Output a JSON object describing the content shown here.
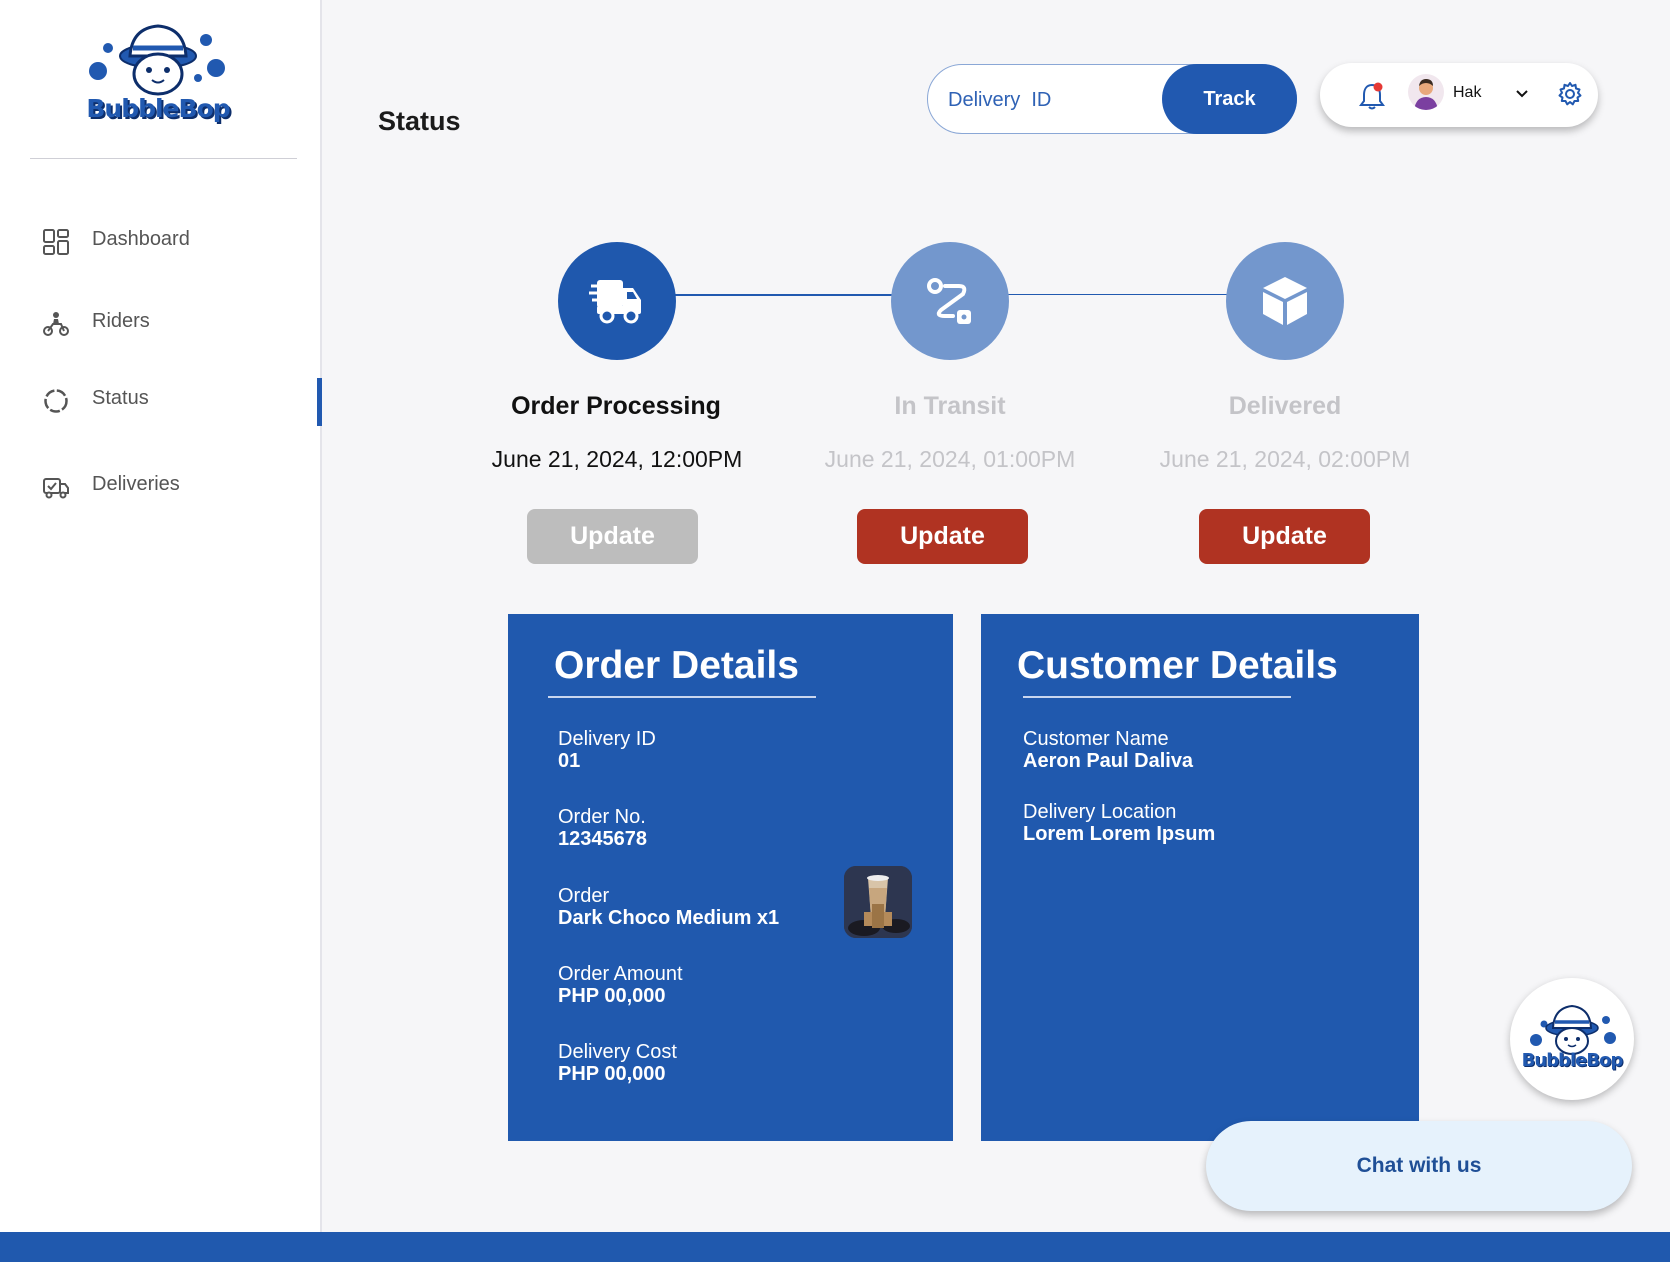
{
  "brand": {
    "logo_text": "BubbleBop"
  },
  "sidebar": {
    "items": [
      {
        "label": "Dashboard",
        "icon": "dashboard-icon"
      },
      {
        "label": "Riders",
        "icon": "motorbike-rider-icon"
      },
      {
        "label": "Status",
        "icon": "status-ring-icon",
        "active": true
      },
      {
        "label": "Deliveries",
        "icon": "delivery-truck-check-icon"
      }
    ]
  },
  "header": {
    "page_title": "Status",
    "track": {
      "placeholder": "Delivery  ID",
      "button_label": "Track"
    },
    "user": {
      "name": "Hak"
    }
  },
  "steps": [
    {
      "title": "Order Processing",
      "date": "June 21, 2024, 12:00PM",
      "state": "active",
      "icon": "delivery-truck-icon",
      "button_label": "Update",
      "button_state": "disabled"
    },
    {
      "title": "In Transit",
      "date": "June 21, 2024, 01:00PM",
      "state": "pending",
      "icon": "route-icon",
      "button_label": "Update",
      "button_state": "enabled"
    },
    {
      "title": "Delivered",
      "date": "June 21, 2024, 02:00PM",
      "state": "pending",
      "icon": "package-box-icon",
      "button_label": "Update",
      "button_state": "enabled"
    }
  ],
  "order_details": {
    "title": "Order Details",
    "fields": [
      {
        "label": "Delivery ID",
        "value": "01"
      },
      {
        "label": "Order No.",
        "value": "12345678"
      },
      {
        "label": "Order",
        "value": "Dark Choco Medium x1"
      },
      {
        "label": "Order Amount",
        "value": "PHP 00,000"
      },
      {
        "label": "Delivery Cost",
        "value": "PHP 00,000"
      }
    ]
  },
  "customer_details": {
    "title": "Customer Details",
    "fields": [
      {
        "label": "Customer Name",
        "value": "Aeron Paul Daliva"
      },
      {
        "label": "Delivery Location",
        "value": "Lorem Lorem Ipsum"
      }
    ]
  },
  "chat": {
    "label": "Chat with us",
    "logo_text": "BubbleBop"
  },
  "colors": {
    "primary": "#2059ae",
    "pending_step": "#7397cd",
    "update_red": "#b03322",
    "update_disabled": "#bdbdbd",
    "notification_dot": "#e53935"
  }
}
